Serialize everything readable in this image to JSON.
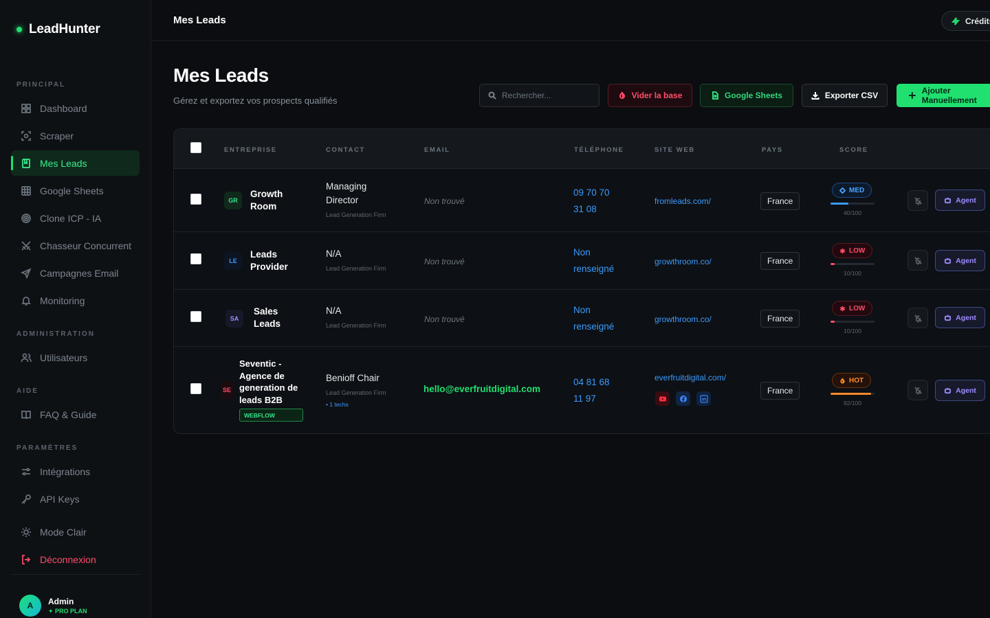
{
  "app": {
    "logo": "LeadHunter"
  },
  "sidebar": {
    "sections": {
      "principal": "PRINCIPAL",
      "administration": "ADMINISTRATION",
      "aide": "AIDE",
      "parametres": "PARAMÈTRES"
    },
    "items": [
      {
        "label": "Dashboard",
        "icon": "grid-icon"
      },
      {
        "label": "Scraper",
        "icon": "scan-icon"
      },
      {
        "label": "Mes Leads",
        "icon": "book-icon",
        "active": true
      },
      {
        "label": "Google Sheets",
        "icon": "table-icon"
      },
      {
        "label": "Clone ICP - IA",
        "icon": "target-icon"
      },
      {
        "label": "Chasseur Concurrent",
        "icon": "swords-icon"
      },
      {
        "label": "Campagnes Email",
        "icon": "send-icon"
      },
      {
        "label": "Monitoring",
        "icon": "bell-icon"
      },
      {
        "label": "Utilisateurs",
        "icon": "users-icon"
      },
      {
        "label": "FAQ & Guide",
        "icon": "open-book-icon"
      },
      {
        "label": "Intégrations",
        "icon": "sliders-icon"
      },
      {
        "label": "API Keys",
        "icon": "key-icon"
      },
      {
        "label": "Mode Clair",
        "icon": "sun-icon"
      },
      {
        "label": "Déconnexion",
        "icon": "logout-icon"
      }
    ],
    "user": {
      "initial": "A",
      "name": "Admin",
      "plan": "✦ PRO PLAN"
    }
  },
  "topbar": {
    "title": "Mes Leads",
    "credits_label": "Crédits"
  },
  "header": {
    "title": "Mes Leads",
    "subtitle": "Gérez et exportez vos prospects qualifiés",
    "search_placeholder": "Rechercher...",
    "buttons": {
      "clear": "Vider la base",
      "sheets": "Google Sheets",
      "export": "Exporter CSV",
      "add": "Ajouter Manuellement"
    }
  },
  "table": {
    "columns": [
      "ENTREPRISE",
      "CONTACT",
      "EMAIL",
      "TÉLÉPHONE",
      "SITE WEB",
      "PAYS",
      "SCORE"
    ],
    "rows": [
      {
        "initials": "GR",
        "company": "Growth Room",
        "contact_role": "Managing Director",
        "contact_firm": "Lead Generation Firm",
        "email": "Non trouvé",
        "phone": "09 70 70 31 08",
        "site": "fromleads.com/",
        "country": "France",
        "score_label": "MED",
        "score_text": "40/100",
        "score_value": 0.4,
        "agent_label": "Agent"
      },
      {
        "initials": "LE",
        "company": "Leads Provider",
        "contact_role": "N/A",
        "contact_firm": "Lead Generation Firm",
        "email": "Non trouvé",
        "phone": "Non renseigné",
        "site": "growthroom.co/",
        "country": "France",
        "score_label": "LOW",
        "score_text": "10/100",
        "score_value": 0.1,
        "agent_label": "Agent"
      },
      {
        "initials": "SA",
        "company": "Sales Leads",
        "contact_role": "N/A",
        "contact_firm": "Lead Generation Firm",
        "email": "Non trouvé",
        "phone": "Non renseigné",
        "site": "growthroom.co/",
        "country": "France",
        "score_label": "LOW",
        "score_text": "10/100",
        "score_value": 0.1,
        "agent_label": "Agent"
      },
      {
        "initials": "SE",
        "company": "Seventic - Agence de generation de leads B2B",
        "tech_chip": "WEBFLOW",
        "contact_role": "Benioff Chair",
        "contact_firm": "Lead Generation Firm",
        "contact_tech": "• 1 techs",
        "email": "hello@everfruitdigital.com",
        "phone": "04 81 68 11 97",
        "site": "everfruitdigital.com/",
        "socials": [
          "youtube-icon",
          "facebook-icon",
          "linkedin-icon"
        ],
        "country": "France",
        "score_label": "HOT",
        "score_text": "92/100",
        "score_value": 0.92,
        "agent_label": "Agent"
      }
    ]
  },
  "colors": {
    "accent": "#20e070",
    "danger": "#ff4d6a",
    "link": "#3b9bff",
    "hot": "#ff8a2a",
    "agent": "#9d8cff"
  }
}
